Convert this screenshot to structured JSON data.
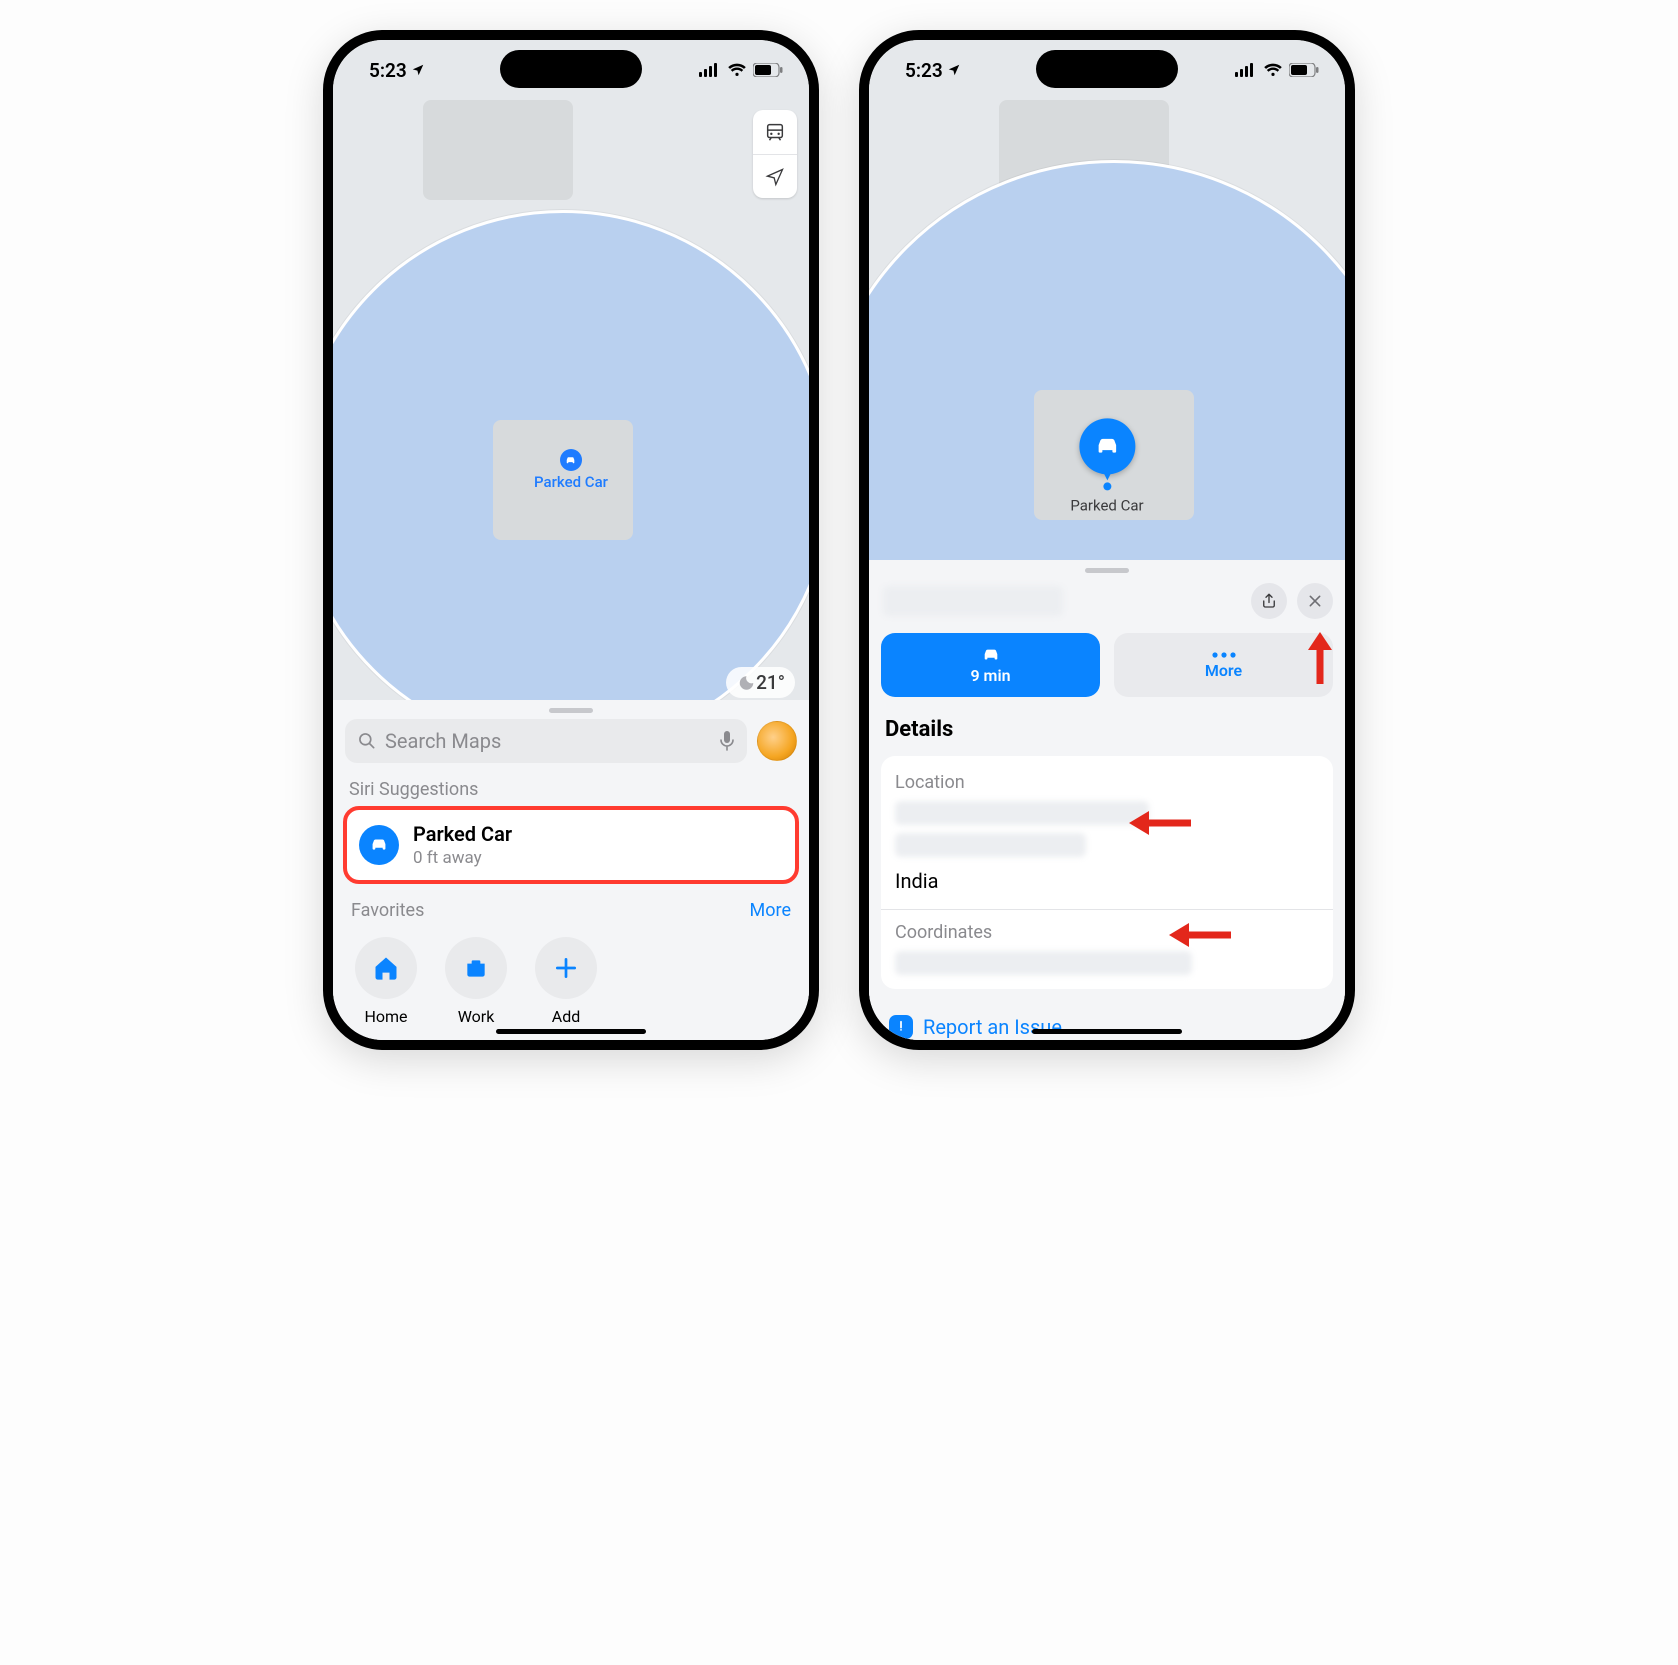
{
  "status": {
    "time": "5:23"
  },
  "left": {
    "weather_temp": "21°",
    "parked_label": "Parked Car",
    "search_placeholder": "Search Maps",
    "siri_header": "Siri Suggestions",
    "suggestion": {
      "title": "Parked Car",
      "subtitle": "0 ft away"
    },
    "favorites_header": "Favorites",
    "favorites_more": "More",
    "favorites": [
      {
        "label": "Home",
        "icon": "home"
      },
      {
        "label": "Work",
        "icon": "briefcase"
      },
      {
        "label": "Add",
        "icon": "plus"
      }
    ]
  },
  "right": {
    "parked_label": "Parked Car",
    "directions_eta": "9 min",
    "more_label": "More",
    "details_header": "Details",
    "location_label": "Location",
    "location_country": "India",
    "coordinates_label": "Coordinates",
    "report_label": "Report an Issue"
  }
}
